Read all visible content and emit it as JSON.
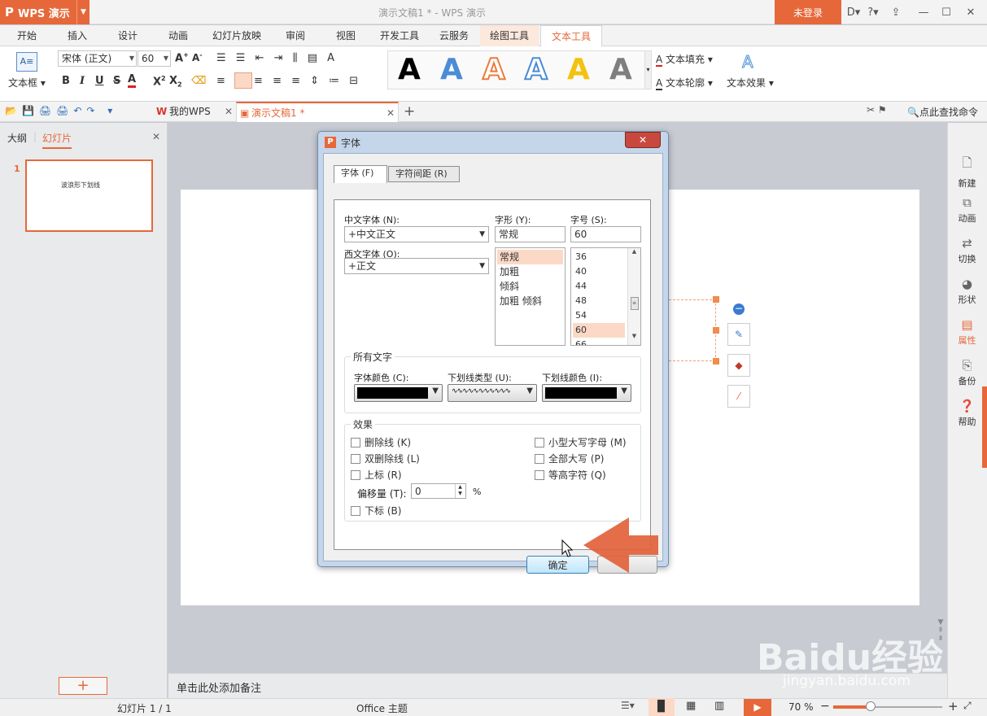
{
  "app": {
    "logo": "P",
    "name": "WPS 演示",
    "window_title": "演示文稿1 * - WPS 演示",
    "login": "未登录"
  },
  "ribbon_tabs": [
    "开始",
    "插入",
    "设计",
    "动画",
    "幻灯片放映",
    "审阅",
    "视图",
    "开发工具",
    "云服务",
    "绘图工具",
    "文本工具"
  ],
  "ribbon": {
    "textbox": "文本框",
    "font_name": "宋体 (正文)",
    "font_size": "60",
    "text_fill": "文本填充",
    "text_outline": "文本轮廓",
    "text_effect": "文本效果",
    "styles": [
      "A",
      "A",
      "A",
      "A",
      "A",
      "A"
    ]
  },
  "quickbar": {
    "my_wps": "我的WPS",
    "doc_tab": "演示文稿1 *",
    "search": "点此查找命令"
  },
  "left_panel": {
    "tab_outline": "大纲",
    "tab_slides": "幻灯片",
    "slide_number": "1",
    "slide_text": "波浪形下划线",
    "add": "+"
  },
  "notes": "单击此处添加备注",
  "right_bar": [
    "新建",
    "动画",
    "切换",
    "形状",
    "属性",
    "备份",
    "帮助"
  ],
  "status": {
    "slide": "幻灯片 1 / 1",
    "theme": "Office 主题",
    "zoom": "70 %"
  },
  "dialog": {
    "title": "字体",
    "close": "✕",
    "tab_font": "字体 (F)",
    "tab_spacing": "字符间距 (R)",
    "cn_font_label": "中文字体 (N):",
    "cn_font": "+中文正文",
    "west_font_label": "西文字体 (O):",
    "west_font": "+正文",
    "style_label": "字形 (Y):",
    "style_value": "常规",
    "styles": [
      "常规",
      "加粗",
      "倾斜",
      "加粗 倾斜"
    ],
    "size_label": "字号 (S):",
    "size_value": "60",
    "sizes": [
      "36",
      "40",
      "44",
      "48",
      "54",
      "60",
      "66"
    ],
    "all_text": "所有文字",
    "color_label": "字体颜色 (C):",
    "underline_label": "下划线类型 (U):",
    "underline_color_label": "下划线颜色 (I):",
    "effects": "效果",
    "strike": "删除线 (K)",
    "double_strike": "双删除线 (L)",
    "superscript": "上标 (R)",
    "offset_label": "偏移量 (T):",
    "offset_value": "0",
    "percent": "%",
    "subscript": "下标 (B)",
    "small_caps": "小型大写字母 (M)",
    "all_caps": "全部大写 (P)",
    "equal_height": "等高字符 (Q)",
    "ok": "确定"
  },
  "watermark": {
    "brand": "Baidu",
    "cn": "经验",
    "url": "jingyan.baidu.com"
  }
}
